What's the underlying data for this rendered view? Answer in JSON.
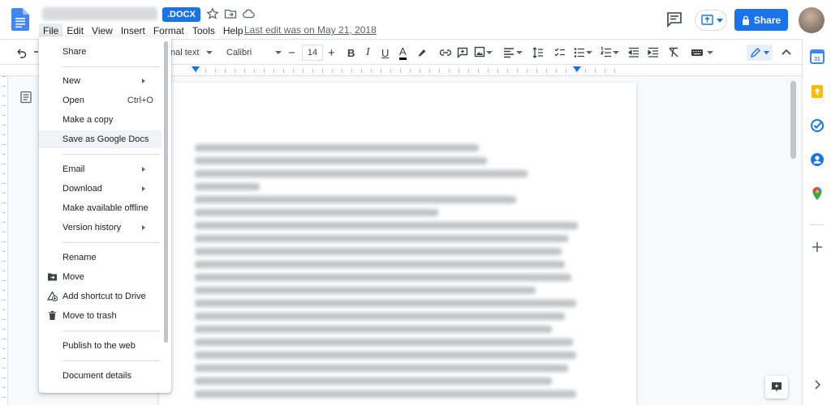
{
  "header": {
    "doc_format_badge": ".DOCX",
    "last_edit": "Last edit was on May 21, 2018",
    "share_label": "Share"
  },
  "menubar": [
    "File",
    "Edit",
    "View",
    "Insert",
    "Format",
    "Tools",
    "Help"
  ],
  "toolbar": {
    "style_value": "nal text",
    "font_value": "Calibri",
    "font_size": "14"
  },
  "file_menu": {
    "share": "Share",
    "new": "New",
    "open": "Open",
    "open_shortcut": "Ctrl+O",
    "make_copy": "Make a copy",
    "save_as_google_docs": "Save as Google Docs",
    "email": "Email",
    "download": "Download",
    "make_offline": "Make available offline",
    "version_history": "Version history",
    "rename": "Rename",
    "move": "Move",
    "add_shortcut": "Add shortcut to Drive",
    "move_to_trash": "Move to trash",
    "publish": "Publish to the web",
    "document_details": "Document details"
  },
  "colors": {
    "accent": "#1a73e8",
    "menu_hover": "#f1f3f4",
    "page": "#ffffff",
    "canvas": "#f8f9fa"
  }
}
